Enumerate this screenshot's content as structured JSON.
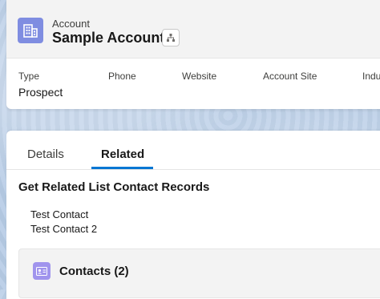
{
  "header": {
    "object_label": "Account",
    "record_name": "Sample Account",
    "icon": "account-icon",
    "hierarchy_icon": "hierarchy-icon"
  },
  "highlights": [
    {
      "label": "Type",
      "value": "Prospect"
    },
    {
      "label": "Phone",
      "value": ""
    },
    {
      "label": "Website",
      "value": ""
    },
    {
      "label": "Account Site",
      "value": ""
    },
    {
      "label": "Indu",
      "value": ""
    }
  ],
  "tabs": [
    {
      "label": "Details",
      "active": false
    },
    {
      "label": "Related",
      "active": true
    }
  ],
  "section": {
    "title": "Get Related List Contact Records",
    "items": [
      "Test Contact",
      "Test Contact 2"
    ]
  },
  "related_list": {
    "title": "Contacts (2)",
    "icon": "contact-card-icon"
  },
  "colors": {
    "account_icon_bg": "#7f8de1",
    "contact_icon_bg": "#a094ed",
    "tab_active_underline": "#0176d3"
  }
}
